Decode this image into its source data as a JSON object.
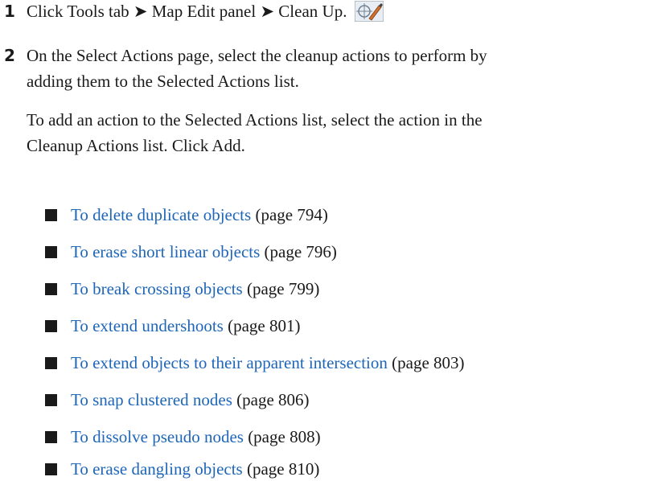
{
  "step1": {
    "number": "1",
    "text": "Click Tools tab ➤ Map Edit panel ➤ Clean Up.",
    "icon": "clean-up-tool-icon"
  },
  "step2": {
    "number": "2",
    "line1": "On the Select Actions page, select the cleanup actions to perform by",
    "line2": "adding them to the Selected Actions list.",
    "para_line1": "To add an action to the Selected Actions list, select the action in the",
    "para_line2": "Cleanup Actions list. Click Add."
  },
  "links": [
    {
      "text": "To delete duplicate objects",
      "page": "(page 794)"
    },
    {
      "text": "To erase short linear objects",
      "page": "(page 796)"
    },
    {
      "text": "To break crossing objects",
      "page": "(page 799)"
    },
    {
      "text": "To extend undershoots",
      "page": "(page 801)"
    },
    {
      "text": "To extend objects to their apparent intersection",
      "page": "(page 803)"
    },
    {
      "text": "To snap clustered nodes",
      "page": "(page 806)"
    },
    {
      "text": "To dissolve pseudo nodes",
      "page": "(page 808)"
    },
    {
      "text": "To erase dangling objects",
      "page": "(page 810)"
    }
  ],
  "colors": {
    "link": "#1e66b8",
    "text": "#1a1a1a"
  }
}
